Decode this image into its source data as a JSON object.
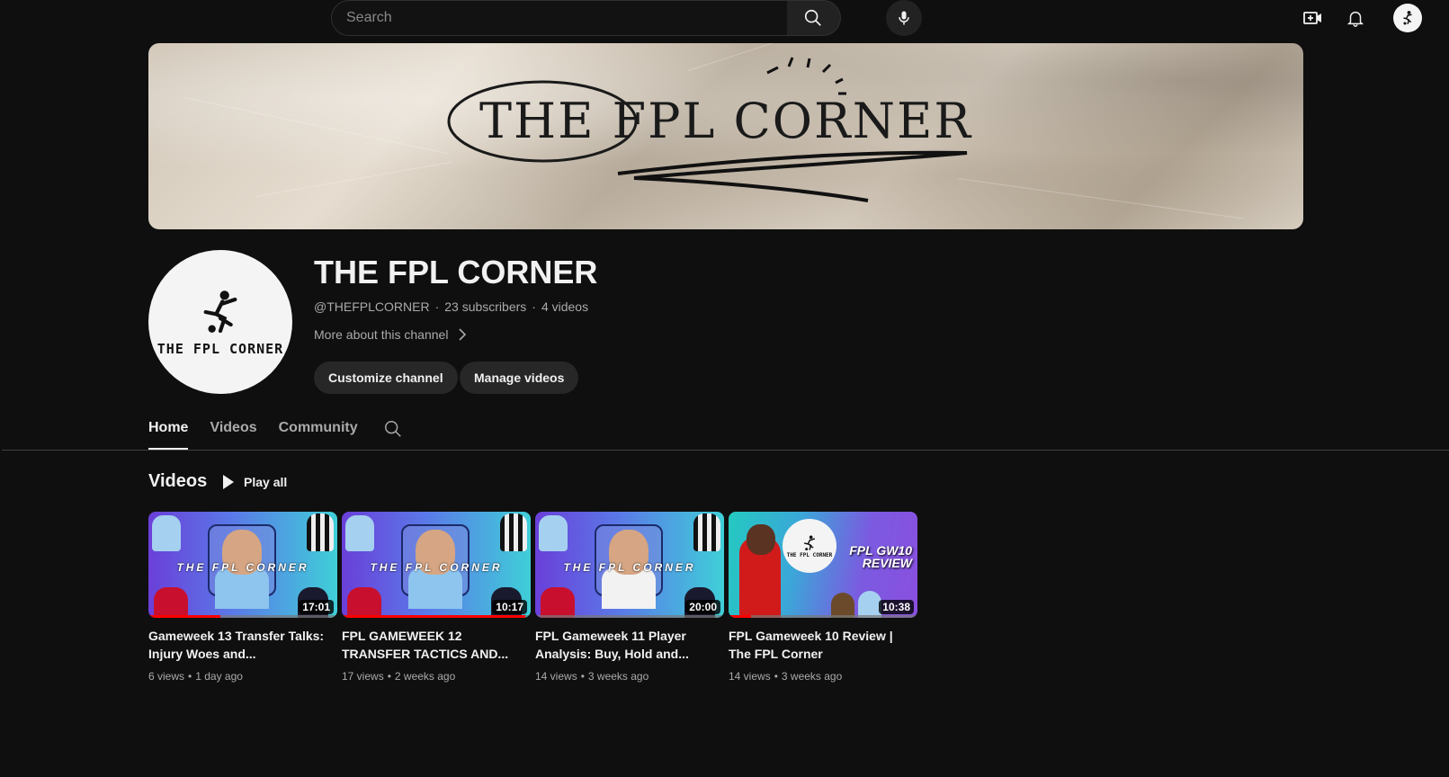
{
  "search": {
    "placeholder": "Search"
  },
  "icons": {
    "search": "search-icon",
    "mic": "mic-icon",
    "create": "create-video-icon",
    "notifications": "bell-icon",
    "avatar": "account-avatar"
  },
  "banner": {
    "title": "THE FPL CORNER"
  },
  "channel": {
    "name": "THE FPL CORNER",
    "avatar_text": "THE FPL CORNER",
    "handle": "@THEFPLCORNER",
    "subscribers": "23 subscribers",
    "videos_count": "4 videos",
    "separator": "·",
    "more_about": "More about this channel",
    "customize_label": "Customize channel",
    "manage_label": "Manage videos"
  },
  "tabs": [
    {
      "label": "Home",
      "active": true
    },
    {
      "label": "Videos",
      "active": false
    },
    {
      "label": "Community",
      "active": false
    }
  ],
  "section": {
    "title": "Videos",
    "play_all": "Play all"
  },
  "videos": [
    {
      "title": "Gameweek 13 Transfer Talks: Injury Woes and...",
      "duration": "17:01",
      "views": "6 views",
      "age": "1 day ago",
      "thumb_text": "THE FPL CORNER",
      "progress": 0.38
    },
    {
      "title": "FPL GAMEWEEK 12 TRANSFER TACTICS AND...",
      "duration": "10:17",
      "views": "17 views",
      "age": "2 weeks ago",
      "thumb_text": "THE FPL CORNER",
      "progress": 0.97
    },
    {
      "title": "FPL Gameweek 11 Player Analysis: Buy, Hold and...",
      "duration": "20:00",
      "views": "14 views",
      "age": "3 weeks ago",
      "thumb_text": "THE FPL CORNER",
      "progress": 0
    },
    {
      "title": "FPL Gameweek 10 Review | The FPL Corner",
      "duration": "10:38",
      "views": "14 views",
      "age": "3 weeks ago",
      "thumb_logo_text": "THE FPL CORNER",
      "thumb_gw_line1": "FPL GW10",
      "thumb_gw_line2": "REVIEW",
      "progress": 0.12
    }
  ],
  "meta_separator": "•",
  "colors": {
    "background": "#0f0f0f",
    "text": "#f1f1f1",
    "secondary_text": "#aaaaaa",
    "progress": "#ff0000",
    "pill": "#272727"
  }
}
